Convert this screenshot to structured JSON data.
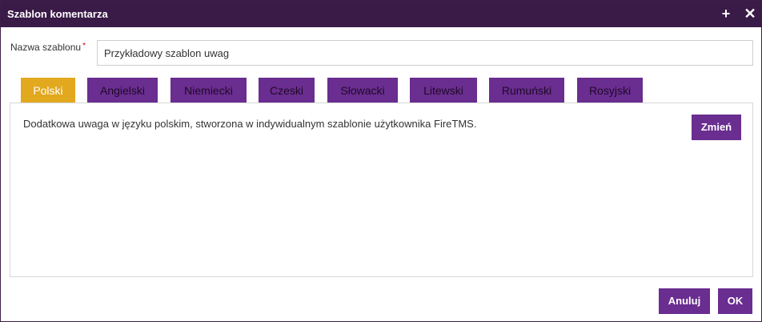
{
  "dialog": {
    "title": "Szablon komentarza",
    "plus_icon": "+",
    "close_icon": "✕"
  },
  "name_field": {
    "label": "Nazwa szablonu",
    "required_mark": "*",
    "value": "Przykładowy szablon uwag"
  },
  "tabs": [
    {
      "label": "Polski",
      "active": true
    },
    {
      "label": "Angielski",
      "active": false
    },
    {
      "label": "Niemiecki",
      "active": false
    },
    {
      "label": "Czeski",
      "active": false
    },
    {
      "label": "Słowacki",
      "active": false
    },
    {
      "label": "Litewski",
      "active": false
    },
    {
      "label": "Rumuński",
      "active": false
    },
    {
      "label": "Rosyjski",
      "active": false
    }
  ],
  "panel": {
    "text": "Dodatkowa uwaga w języku polskim, stworzona w indywidualnym szablonie użytkownika FireTMS.",
    "change_label": "Zmień"
  },
  "footer": {
    "cancel_label": "Anuluj",
    "ok_label": "OK"
  },
  "colors": {
    "titlebar": "#3a1a47",
    "accent_purple": "#6a2d90",
    "active_tab": "#e2a81e"
  }
}
